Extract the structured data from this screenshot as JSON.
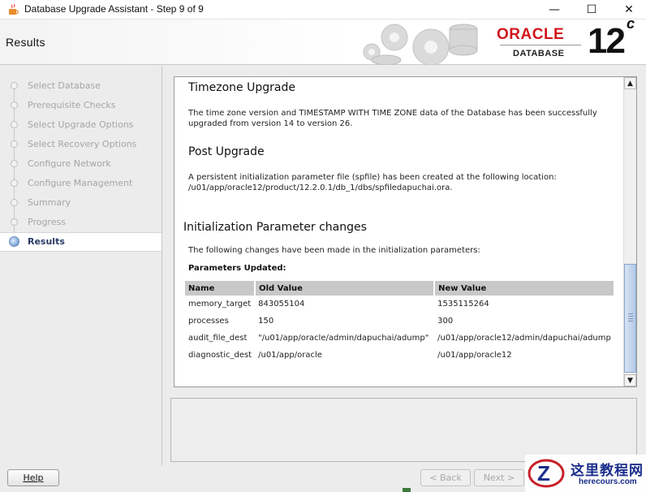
{
  "window": {
    "title": "Database Upgrade Assistant - Step 9 of 9",
    "minimize_glyph": "—",
    "maximize_glyph": "☐",
    "close_glyph": "✕"
  },
  "header": {
    "page_title": "Results",
    "brand_name": "ORACLE",
    "brand_sub": "DATABASE",
    "version_number": "12",
    "version_letter": "c"
  },
  "steps": [
    {
      "label": "Select Database",
      "state": "done"
    },
    {
      "label": "Prerequisite Checks",
      "state": "done"
    },
    {
      "label": "Select Upgrade Options",
      "state": "done"
    },
    {
      "label": "Select Recovery Options",
      "state": "done"
    },
    {
      "label": "Configure Network",
      "state": "done"
    },
    {
      "label": "Configure Management",
      "state": "done"
    },
    {
      "label": "Summary",
      "state": "done"
    },
    {
      "label": "Progress",
      "state": "done"
    },
    {
      "label": "Results",
      "state": "active"
    }
  ],
  "content": {
    "timezone": {
      "title": "Timezone Upgrade",
      "line1": "The time zone version and TIMESTAMP WITH TIME ZONE data of the Database has been successfully",
      "line2": "upgraded from version 14 to version 26."
    },
    "post_upgrade": {
      "title": "Post Upgrade",
      "line1": "A persistent initialization parameter file (spfile) has been created at the following location:",
      "line2": "/u01/app/oracle12/product/12.2.0.1/db_1/dbs/spfiledapuchai.ora."
    },
    "init_params": {
      "title": "Initialization Parameter changes",
      "description": "The following changes have been made in the initialization parameters:",
      "updated_label": "Parameters Updated:",
      "columns": [
        "Name",
        "Old Value",
        "New Value"
      ],
      "rows": [
        [
          "memory_target",
          "843055104",
          "1535115264"
        ],
        [
          "processes",
          "150",
          "300"
        ],
        [
          "audit_file_dest",
          "\"/u01/app/oracle/admin/dapuchai/adump\"",
          "/u01/app/oracle12/admin/dapuchai/adump"
        ],
        [
          "diagnostic_dest",
          "/u01/app/oracle",
          "/u01/app/oracle12"
        ]
      ]
    }
  },
  "scrollbar": {
    "up_glyph": "▲",
    "down_glyph": "▼"
  },
  "footer": {
    "help_label": "Help",
    "back_label": "< Back",
    "next_label": "Next >"
  },
  "watermark": {
    "text_cn": "这里教程网",
    "text_url": "herecours.com"
  }
}
